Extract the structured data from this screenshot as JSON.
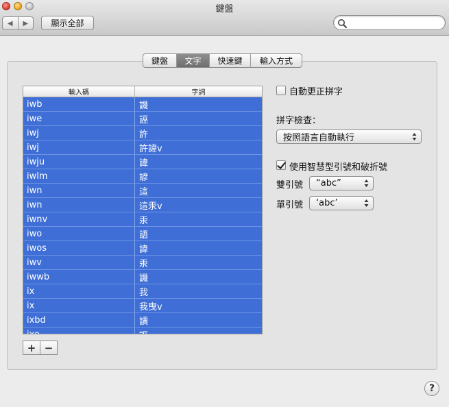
{
  "window": {
    "title": "鍵盤"
  },
  "toolbar": {
    "show_all_label": "顯示全部",
    "search_placeholder": ""
  },
  "tabs": [
    {
      "label": "鍵盤",
      "selected": false
    },
    {
      "label": "文字",
      "selected": true
    },
    {
      "label": "快速鍵",
      "selected": false
    },
    {
      "label": "輸入方式",
      "selected": false
    }
  ],
  "table": {
    "columns": [
      "輸入碼",
      "字詞"
    ],
    "rows": [
      {
        "code": "iwb",
        "word": "譏"
      },
      {
        "code": "iwe",
        "word": "誣"
      },
      {
        "code": "iwj",
        "word": "許"
      },
      {
        "code": "iwj",
        "word": "許諱v"
      },
      {
        "code": "iwju",
        "word": "諱"
      },
      {
        "code": "iwlm",
        "word": "諺"
      },
      {
        "code": "iwn",
        "word": "這"
      },
      {
        "code": "iwn",
        "word": "這汞v"
      },
      {
        "code": "iwnv",
        "word": "汞"
      },
      {
        "code": "iwo",
        "word": "語"
      },
      {
        "code": "iwos",
        "word": "諱"
      },
      {
        "code": "iwv",
        "word": "汞"
      },
      {
        "code": "iwwb",
        "word": "譏"
      },
      {
        "code": "ix",
        "word": "我"
      },
      {
        "code": "ix",
        "word": "我曳v"
      },
      {
        "code": "ixbd",
        "word": "讀"
      },
      {
        "code": "ixe",
        "word": "誑"
      }
    ],
    "add_label": "+",
    "remove_label": "−"
  },
  "options": {
    "auto_correct": {
      "label": "自動更正拼字",
      "checked": false
    },
    "spelling_label": "拼字檢查：",
    "spelling_value": "按照語言自動執行",
    "smart_quotes": {
      "label": "使用智慧型引號和破折號",
      "checked": true
    },
    "double_label": "雙引號",
    "double_value": "“abc”",
    "single_label": "單引號",
    "single_value": "‘abc’"
  },
  "help_label": "?"
}
